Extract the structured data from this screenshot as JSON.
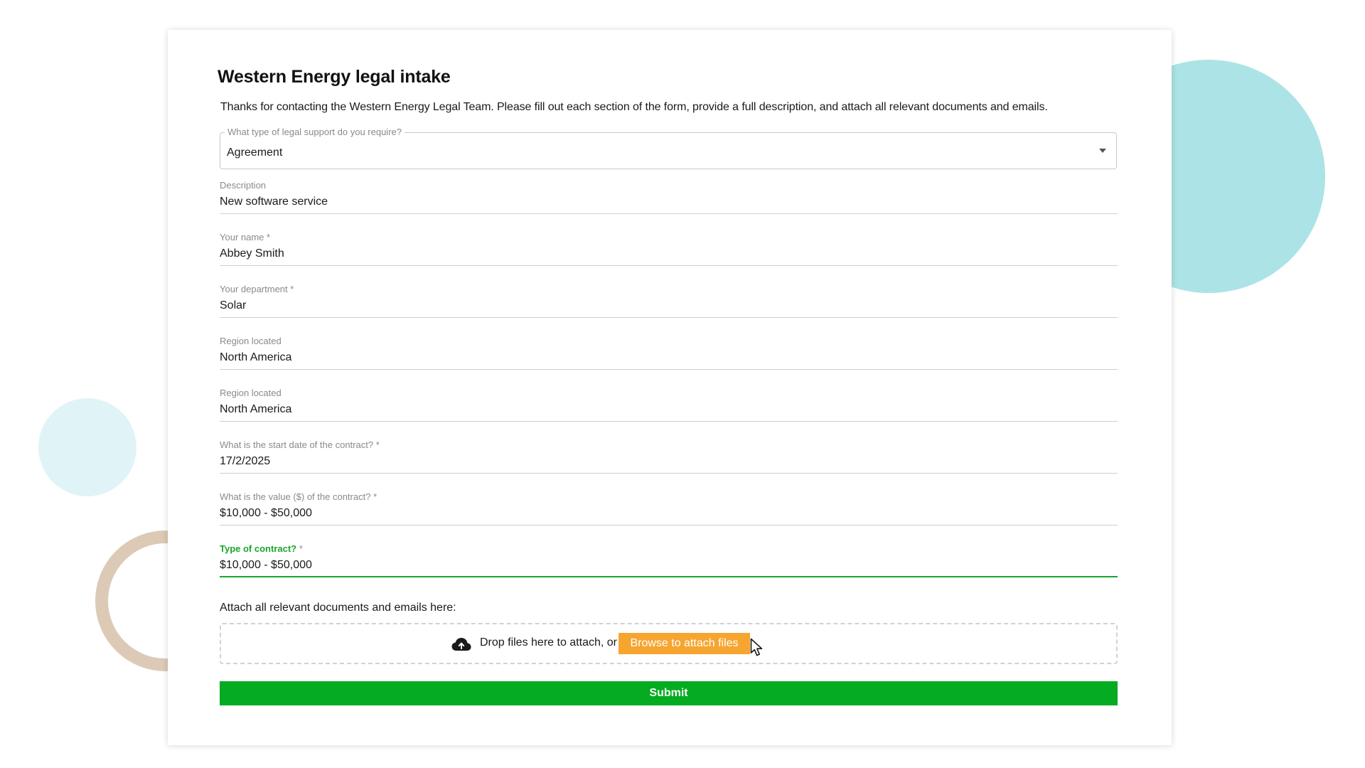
{
  "form": {
    "title": "Western Energy legal intake",
    "intro": "Thanks for contacting the Western Energy Legal Team. Please fill out each section of the form, provide a full description, and attach all relevant documents and emails.",
    "support_type": {
      "label": "What type of legal support do you require?",
      "value": "Agreement"
    },
    "fields": [
      {
        "label": "Description",
        "required": "",
        "value": "New software service"
      },
      {
        "label": "Your name",
        "required": "*",
        "value": "Abbey Smith"
      },
      {
        "label": "Your department",
        "required": "*",
        "value": "Solar"
      },
      {
        "label": "Region located",
        "required": "",
        "value": "North America"
      },
      {
        "label": "Region located",
        "required": "",
        "value": "North America"
      },
      {
        "label": "What is the start date of the contract?",
        "required": "*",
        "value": "17/2/2025"
      },
      {
        "label": "What is the value ($) of the contract?",
        "required": "*",
        "value": "$10,000 - $50,000"
      },
      {
        "label": "Type of contract?",
        "required": "*",
        "value": "$10,000 - $50,000"
      }
    ],
    "attach": {
      "label": "Attach all relevant documents and emails here:",
      "drop_text": "Drop files here to attach, or",
      "browse_label": "Browse to attach files"
    },
    "submit_label": "Submit"
  },
  "icons": {
    "upload": "cloud-upload-icon",
    "cursor": "mouse-pointer-icon",
    "dropdown": "dropdown-arrow-icon"
  },
  "colors": {
    "accent_green": "#05ac21",
    "active_label_green": "#1aa52c",
    "browse_orange": "#f6a530",
    "deco_teal": "#ace3e6",
    "deco_light_blue": "#e0f4f7",
    "deco_beige": "#dccab6"
  }
}
